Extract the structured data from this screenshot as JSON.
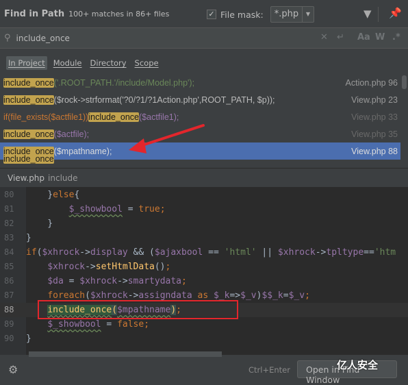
{
  "header": {
    "title": "Find in Path",
    "summary": "100+ matches in 86+ files",
    "file_mask_checked": true,
    "file_mask_label": "File mask:",
    "file_mask_value": "*.php",
    "filter_icon": "filter-icon",
    "pin_icon": "pin-icon"
  },
  "search": {
    "value": "include_once",
    "options": [
      "Aa",
      "W",
      ".*"
    ]
  },
  "scopes": [
    {
      "label": "In Project",
      "active": true
    },
    {
      "label": "Module"
    },
    {
      "label": "Directory"
    },
    {
      "label": "Scope"
    }
  ],
  "results": [
    {
      "match": "include_once",
      "rest": "('.ROOT_PATH.'/include/Model.php');",
      "file": "Action.php 96"
    },
    {
      "match": "include_once",
      "rest": "($rock->strformat('?0/?1/?1Action.php',ROOT_PATH, $p));",
      "file": "View.php 23"
    },
    {
      "pre": "if(file_exists($actfile1))",
      "match": "include_once",
      "rest": "($actfile1);",
      "file": "View.php 33"
    },
    {
      "match": "include_once",
      "rest": "($actfile);",
      "file": "View.php 35"
    },
    {
      "match": "include_once",
      "rest": "($mpathname);",
      "file": "View.php 88",
      "selected": true
    },
    {
      "match": "include_once"
    }
  ],
  "preview": {
    "file": "View.php",
    "context": "include"
  },
  "code": {
    "lines": [
      "80",
      "81",
      "82",
      "83",
      "84",
      "85",
      "86",
      "87",
      "88",
      "89",
      "90"
    ],
    "current_line": "88"
  },
  "footer": {
    "shortcut": "Ctrl+Enter",
    "open_button": "Open in Find Window",
    "watermark": "亿人安全"
  },
  "colors": {
    "selection": "#4b6eaf",
    "match_highlight": "#c2a34e",
    "annotation_red": "#e3262c"
  }
}
